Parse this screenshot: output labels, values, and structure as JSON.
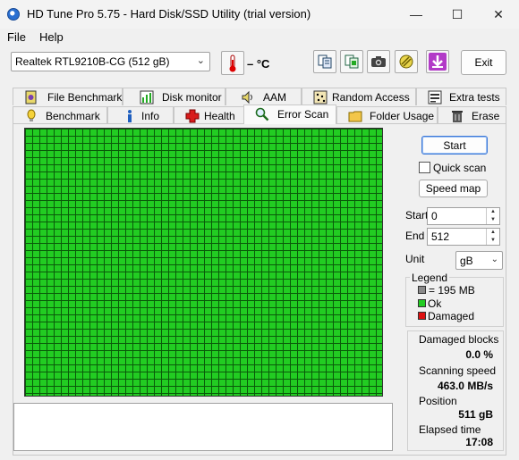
{
  "window": {
    "title": "HD Tune Pro 5.75 - Hard Disk/SSD Utility (trial version)",
    "minimize_glyph": "—",
    "maximize_glyph": "☐",
    "close_glyph": "✕"
  },
  "menu": {
    "file": "File",
    "help": "Help"
  },
  "toolbar": {
    "drive": "Realtek RTL9210B-CG (512 gB)",
    "temperature": "– °C",
    "exit_label": "Exit"
  },
  "tabs": {
    "row1": [
      {
        "label": "File Benchmark",
        "icon": "file-benchmark-icon"
      },
      {
        "label": "Disk monitor",
        "icon": "disk-monitor-icon"
      },
      {
        "label": "AAM",
        "icon": "speaker-icon"
      },
      {
        "label": "Random Access",
        "icon": "random-access-icon"
      },
      {
        "label": "Extra tests",
        "icon": "extra-tests-icon"
      }
    ],
    "row2": [
      {
        "label": "Benchmark",
        "icon": "benchmark-icon"
      },
      {
        "label": "Info",
        "icon": "info-icon"
      },
      {
        "label": "Health",
        "icon": "health-cross-icon"
      },
      {
        "label": "Error Scan",
        "icon": "magnifier-icon"
      },
      {
        "label": "Folder Usage",
        "icon": "folder-icon"
      },
      {
        "label": "Erase",
        "icon": "trash-icon"
      }
    ]
  },
  "error_scan": {
    "start_button": "Start",
    "quick_scan_label": "Quick scan",
    "quick_scan_checked": false,
    "speed_map_button": "Speed map",
    "start_label": "Start",
    "start_value": "0",
    "end_label": "End",
    "end_value": "512",
    "unit_label": "Unit",
    "unit_value": "gB",
    "legend": {
      "title": "Legend",
      "block_size": "= 195 MB",
      "ok": "Ok",
      "damaged": "Damaged",
      "colors": {
        "block": "#8a8a8a",
        "ok": "#22cc22",
        "damaged": "#dd1111"
      }
    },
    "stats": {
      "damaged_blocks_label": "Damaged blocks",
      "damaged_blocks_value": "0.0 %",
      "scanning_speed_label": "Scanning speed",
      "scanning_speed_value": "463.0 MB/s",
      "position_label": "Position",
      "position_value": "511 gB",
      "elapsed_label": "Elapsed time",
      "elapsed_value": "17:08"
    },
    "scan_progress": 1.0
  }
}
